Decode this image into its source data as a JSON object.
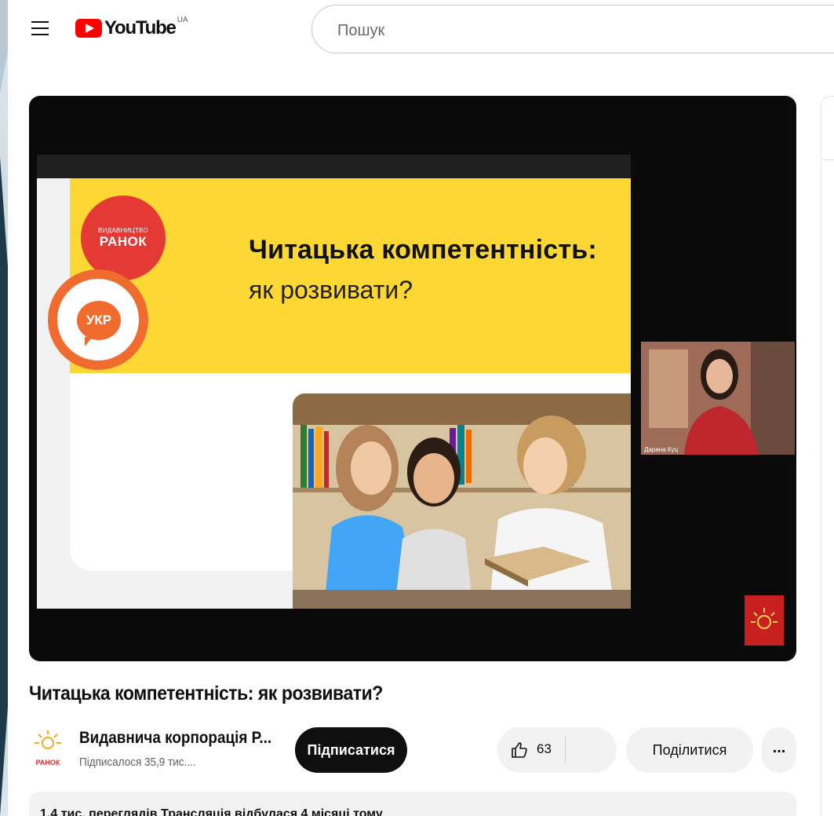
{
  "header": {
    "logo_text": "YouTube",
    "country_code": "UA",
    "search_placeholder": "Пошук"
  },
  "video": {
    "slide_title": "Читацька компетентність:",
    "slide_subtitle": "як розвивати?",
    "badge_red_small": "ВИДАВНИЦТВО",
    "badge_red_big": "РАНОК",
    "badge_orange": "УКР",
    "cam_name": "Дарина Куц"
  },
  "title": "Читацька компетентність: як розвивати?",
  "channel": {
    "name": "Видавнича корпорація Р...",
    "subscribers": "Підписалося 35,9 тис....",
    "logo_text": "РАНОК"
  },
  "actions": {
    "subscribe_label": "Підписатися",
    "like_count": "63",
    "share_label": "Поділитися",
    "more_label": "..."
  },
  "description": {
    "meta": "1,4 тис. переглядів  Трансляція відбулася 4 місяці тому"
  },
  "colors": {
    "brand_red": "#ff0000",
    "slide_yellow": "#fdd835",
    "ranok_red": "#e53935",
    "ukr_orange": "#ef6c2e"
  }
}
